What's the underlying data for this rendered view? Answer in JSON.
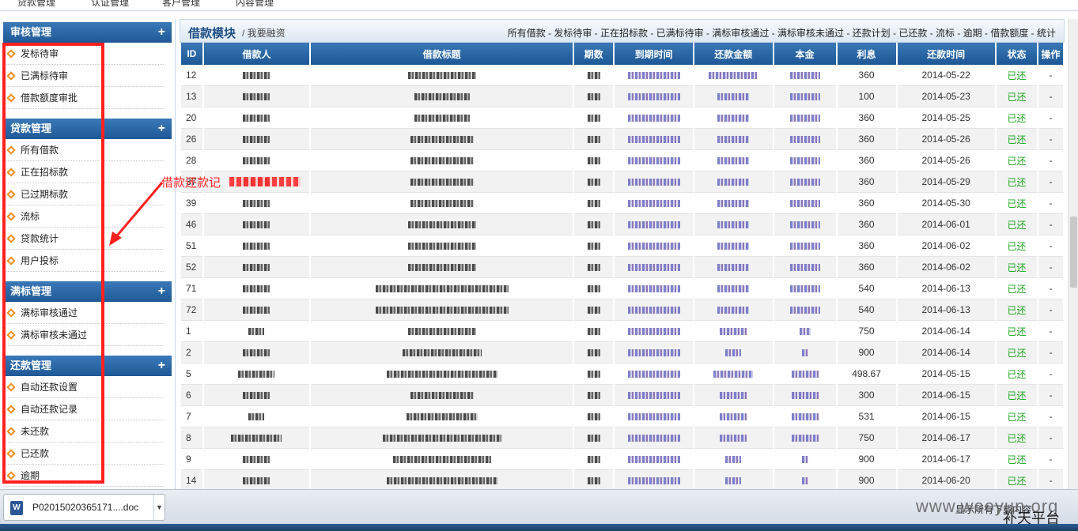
{
  "topnav": [
    "贷款管理",
    "认证管理",
    "客户管理",
    "内容管理"
  ],
  "sidebar": {
    "groups": [
      {
        "title": "审核管理",
        "items": [
          "发标待审",
          "已满标待审",
          "借款额度审批"
        ]
      },
      {
        "title": "贷款管理",
        "items": [
          "所有借款",
          "正在招标款",
          "已过期标款",
          "流标",
          "贷款统计",
          "用户投标"
        ]
      },
      {
        "title": "满标管理",
        "items": [
          "满标审核通过",
          "满标审核未通过"
        ]
      },
      {
        "title": "还款管理",
        "items": [
          "自动还款设置",
          "自动还款记录",
          "未还款",
          "已还款",
          "逾期"
        ]
      }
    ]
  },
  "annotation": {
    "text": "借款还款记"
  },
  "main": {
    "title": "借款模块",
    "subtitle": "/ 我要融资",
    "links": "所有借款 - 发标待审 - 正在招标款 - 已满标待审 - 满标审核通过 - 满标审核未通过 - 还款计划 - 已还款 - 流标 - 逾期 - 借款额度 - 统计"
  },
  "table": {
    "headers": [
      "ID",
      "借款人",
      "借款标题",
      "期数",
      "到期时间",
      "还款金额",
      "本金",
      "利息",
      "还款时间",
      "状态",
      "操作"
    ],
    "rows": [
      {
        "id": "12",
        "interest": "360",
        "date": "2014-05-22",
        "status": "已还",
        "op": "-"
      },
      {
        "id": "13",
        "interest": "100",
        "date": "2014-05-23",
        "status": "已还",
        "op": "-"
      },
      {
        "id": "20",
        "interest": "360",
        "date": "2014-05-25",
        "status": "已还",
        "op": "-"
      },
      {
        "id": "26",
        "interest": "360",
        "date": "2014-05-26",
        "status": "已还",
        "op": "-"
      },
      {
        "id": "28",
        "interest": "360",
        "date": "2014-05-26",
        "status": "已还",
        "op": "-"
      },
      {
        "id": "37",
        "interest": "360",
        "date": "2014-05-29",
        "status": "已还",
        "op": "-"
      },
      {
        "id": "39",
        "interest": "360",
        "date": "2014-05-30",
        "status": "已还",
        "op": "-"
      },
      {
        "id": "46",
        "interest": "360",
        "date": "2014-06-01",
        "status": "已还",
        "op": "-"
      },
      {
        "id": "51",
        "interest": "360",
        "date": "2014-06-02",
        "status": "已还",
        "op": "-"
      },
      {
        "id": "52",
        "interest": "360",
        "date": "2014-06-02",
        "status": "已还",
        "op": "-"
      },
      {
        "id": "71",
        "interest": "540",
        "date": "2014-06-13",
        "status": "已还",
        "op": "-"
      },
      {
        "id": "72",
        "interest": "540",
        "date": "2014-06-13",
        "status": "已还",
        "op": "-"
      },
      {
        "id": "1",
        "interest": "750",
        "date": "2014-06-14",
        "status": "已还",
        "op": "-"
      },
      {
        "id": "2",
        "interest": "900",
        "date": "2014-06-14",
        "status": "已还",
        "op": "-"
      },
      {
        "id": "5",
        "interest": "498.67",
        "date": "2014-05-15",
        "status": "已还",
        "op": "-"
      },
      {
        "id": "6",
        "interest": "300",
        "date": "2014-06-15",
        "status": "已还",
        "op": "-"
      },
      {
        "id": "7",
        "interest": "531",
        "date": "2014-06-15",
        "status": "已还",
        "op": "-"
      },
      {
        "id": "8",
        "interest": "750",
        "date": "2014-06-17",
        "status": "已还",
        "op": "-"
      },
      {
        "id": "9",
        "interest": "900",
        "date": "2014-06-17",
        "status": "已还",
        "op": "-"
      },
      {
        "id": "14",
        "interest": "900",
        "date": "2014-06-20",
        "status": "已还",
        "op": "-"
      }
    ]
  },
  "download": {
    "filename": "P02015020365171....doc",
    "file_icon": "word-doc-icon",
    "show_all": "显示所有下载内容"
  },
  "watermark": {
    "text": "www.wooyun.org",
    "text2": "补天平台"
  },
  "colors": {
    "header_blue": "#1f5896",
    "status_green": "#1aa31a",
    "annotation_red": "#ff2020",
    "bullet_orange": "#f08c1e"
  }
}
